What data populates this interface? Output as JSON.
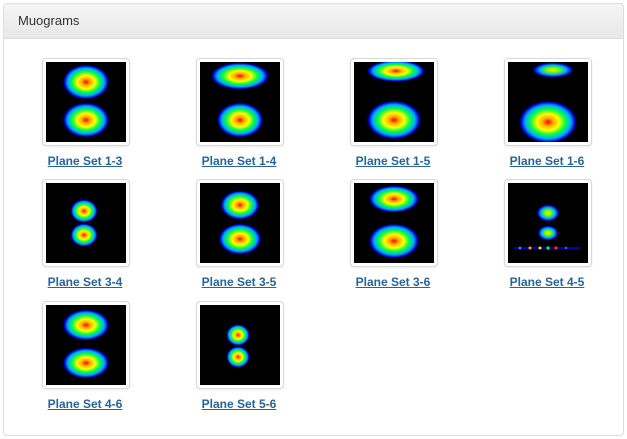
{
  "panel": {
    "title": "Muograms"
  },
  "muograms": [
    {
      "label": "Plane Set 1-3"
    },
    {
      "label": "Plane Set 1-4"
    },
    {
      "label": "Plane Set 1-5"
    },
    {
      "label": "Plane Set 1-6"
    },
    {
      "label": "Plane Set 3-4"
    },
    {
      "label": "Plane Set 3-5"
    },
    {
      "label": "Plane Set 3-6"
    },
    {
      "label": "Plane Set 4-5"
    },
    {
      "label": "Plane Set 4-6"
    },
    {
      "label": "Plane Set 5-6"
    }
  ]
}
